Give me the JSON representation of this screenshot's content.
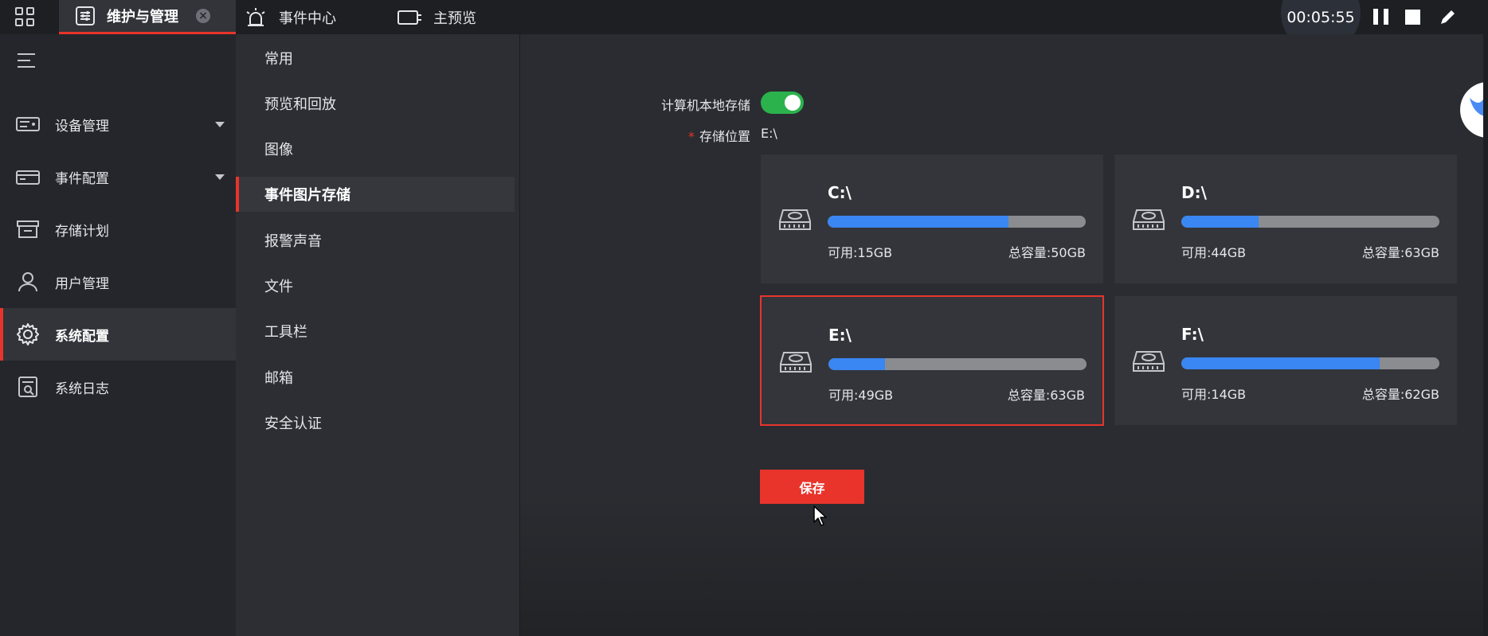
{
  "topbar": {
    "tabs": [
      {
        "label": "维护与管理",
        "active": true,
        "closable": true
      },
      {
        "label": "事件中心",
        "active": false
      },
      {
        "label": "主预览",
        "active": false
      }
    ],
    "timer": "00:05:55"
  },
  "leftnav": {
    "items": [
      {
        "label": "设备管理",
        "icon": "device-icon",
        "expandable": true
      },
      {
        "label": "事件配置",
        "icon": "event-config-icon",
        "expandable": true
      },
      {
        "label": "存储计划",
        "icon": "storage-plan-icon"
      },
      {
        "label": "用户管理",
        "icon": "user-icon"
      },
      {
        "label": "系统配置",
        "icon": "gear-icon",
        "active": true
      },
      {
        "label": "系统日志",
        "icon": "log-icon"
      }
    ]
  },
  "subnav": {
    "items": [
      {
        "label": "常用"
      },
      {
        "label": "预览和回放"
      },
      {
        "label": "图像"
      },
      {
        "label": "事件图片存储",
        "active": true
      },
      {
        "label": "报警声音"
      },
      {
        "label": "文件"
      },
      {
        "label": "工具栏"
      },
      {
        "label": "邮箱"
      },
      {
        "label": "安全认证"
      }
    ]
  },
  "form": {
    "local_storage_label": "计算机本地存储",
    "local_storage_enabled": true,
    "location_required": "*",
    "location_label": "存储位置",
    "location_value": "E:\\"
  },
  "drives": [
    {
      "name": "C:\\",
      "available": "可用:15GB",
      "total": "总容量:50GB",
      "used_fraction": 0.7,
      "selected": false
    },
    {
      "name": "D:\\",
      "available": "可用:44GB",
      "total": "总容量:63GB",
      "used_fraction": 0.3,
      "selected": false
    },
    {
      "name": "E:\\",
      "available": "可用:49GB",
      "total": "总容量:63GB",
      "used_fraction": 0.22,
      "selected": true
    },
    {
      "name": "F:\\",
      "available": "可用:14GB",
      "total": "总容量:62GB",
      "used_fraction": 0.77,
      "selected": false
    }
  ],
  "save_label": "保存",
  "colors": {
    "accent": "#e8342b",
    "progress": "#3a86f2",
    "toggle_on": "#2bb24c"
  }
}
